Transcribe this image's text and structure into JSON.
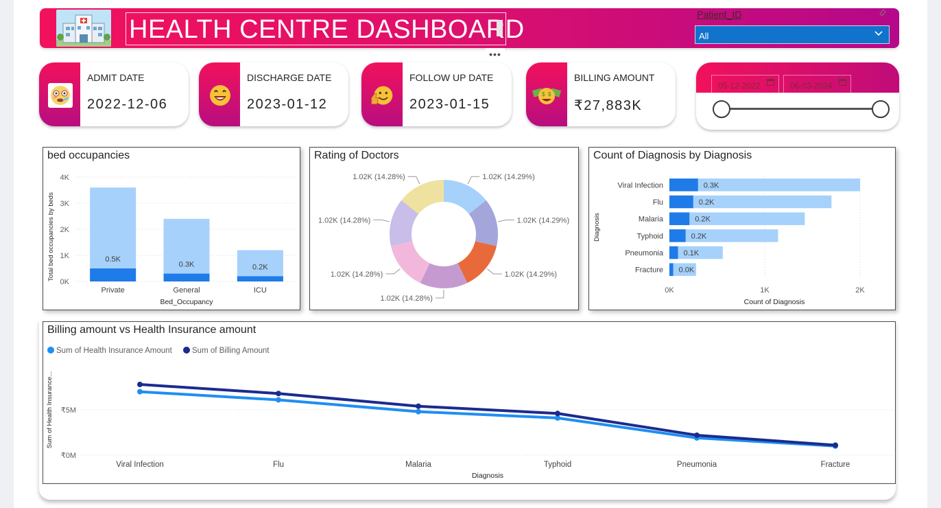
{
  "header": {
    "title": "HEALTH CENTRE DASHBOARD",
    "more_options": "•••",
    "patient_slicer": {
      "label": "Patient_ID",
      "selected": "All"
    }
  },
  "kpis": [
    {
      "label": "ADMIT DATE",
      "value": "2022-12-06",
      "icon": "sick-face-emoji-icon"
    },
    {
      "label": "DISCHARGE DATE",
      "value": "2023-01-12",
      "icon": "grinning-face-emoji-icon"
    },
    {
      "label": "FOLLOW UP DATE",
      "value": "2023-01-15",
      "icon": "thumbs-up-emoji-icon"
    },
    {
      "label": "BILLING AMOUNT",
      "value": "₹27,883K",
      "icon": "money-face-emoji-icon"
    }
  ],
  "date_slicer": {
    "start": "05-12-2022",
    "end": "06-03-2024"
  },
  "colors": {
    "header_start": "#f2115c",
    "header_end": "#b5088a",
    "light_blue": "#a6d1fb",
    "dark_blue": "#1f7be8",
    "navy": "#1b2b8e"
  },
  "bed_chart": {
    "title": "bed occupancies",
    "chart_data": {
      "type": "bar",
      "categories": [
        "Private",
        "General",
        "ICU"
      ],
      "series": [
        {
          "values": [
            3600,
            2400,
            1200
          ]
        },
        {
          "values": [
            500,
            300,
            200
          ]
        }
      ],
      "data_labels": [
        "0.5K",
        "0.3K",
        "0.2K"
      ],
      "xlabel": "Bed_Occupancy",
      "ylabel": "Total bed occupancies by beds",
      "yticks": [
        "0K",
        "1K",
        "2K",
        "3K",
        "4K"
      ],
      "ylim": [
        0,
        4000
      ]
    }
  },
  "doctor_chart": {
    "title": "Rating of Doctors",
    "chart_data": {
      "type": "pie",
      "slices": [
        {
          "label": "1.02K (14.29%)",
          "value": 14.29,
          "color": "#a6d1fb"
        },
        {
          "label": "1.02K (14.29%)",
          "value": 14.29,
          "color": "#a3a5db"
        },
        {
          "label": "1.02K (14.29%)",
          "value": 14.29,
          "color": "#e86a3a"
        },
        {
          "label": "1.02K (14.28%)",
          "value": 14.28,
          "color": "#c59ad0"
        },
        {
          "label": "1.02K (14.28%)",
          "value": 14.28,
          "color": "#f2b8dc"
        },
        {
          "label": "1.02K (14.28%)",
          "value": 14.28,
          "color": "#c9bde9"
        },
        {
          "label": "1.02K (14.28%)",
          "value": 14.28,
          "color": "#efe2a0"
        }
      ]
    }
  },
  "diagnosis_chart": {
    "title": "Count of Diagnosis by Diagnosis",
    "chart_data": {
      "type": "bar",
      "orientation": "horizontal",
      "categories": [
        "Viral Infection",
        "Flu",
        "Malaria",
        "Typhoid",
        "Pneumonia",
        "Fracture"
      ],
      "series": [
        {
          "values": [
            2000,
            1700,
            1420,
            1140,
            560,
            280
          ]
        },
        {
          "values": [
            300,
            250,
            210,
            170,
            90,
            40
          ]
        }
      ],
      "data_labels": [
        "0.3K",
        "0.2K",
        "0.2K",
        "0.2K",
        "0.1K",
        "0.0K"
      ],
      "xlabel": "Count of Diagnosis",
      "ylabel": "Diagnosis",
      "xticks": [
        "0K",
        "1K",
        "2K"
      ],
      "xlim": [
        0,
        2000
      ]
    }
  },
  "billing_chart": {
    "title": "Billing amount vs Health Insurance amount",
    "chart_data": {
      "type": "line",
      "categories": [
        "Viral Infection",
        "Flu",
        "Malaria",
        "Typhoid",
        "Pneumonia",
        "Fracture"
      ],
      "series": [
        {
          "name": "Sum of Health Insurance Amount",
          "color": "#1f8ef1",
          "values": [
            7.0,
            6.1,
            4.8,
            4.1,
            1.9,
            1.0
          ]
        },
        {
          "name": "Sum of Billing Amount",
          "color": "#1b2b8e",
          "values": [
            7.8,
            6.8,
            5.4,
            4.6,
            2.2,
            1.1
          ]
        }
      ],
      "xlabel": "Diagnosis",
      "ylabel": "Sum of Health Insurance...",
      "yticks": [
        "₹0M",
        "₹5M"
      ],
      "ylim": [
        0,
        10
      ]
    }
  }
}
